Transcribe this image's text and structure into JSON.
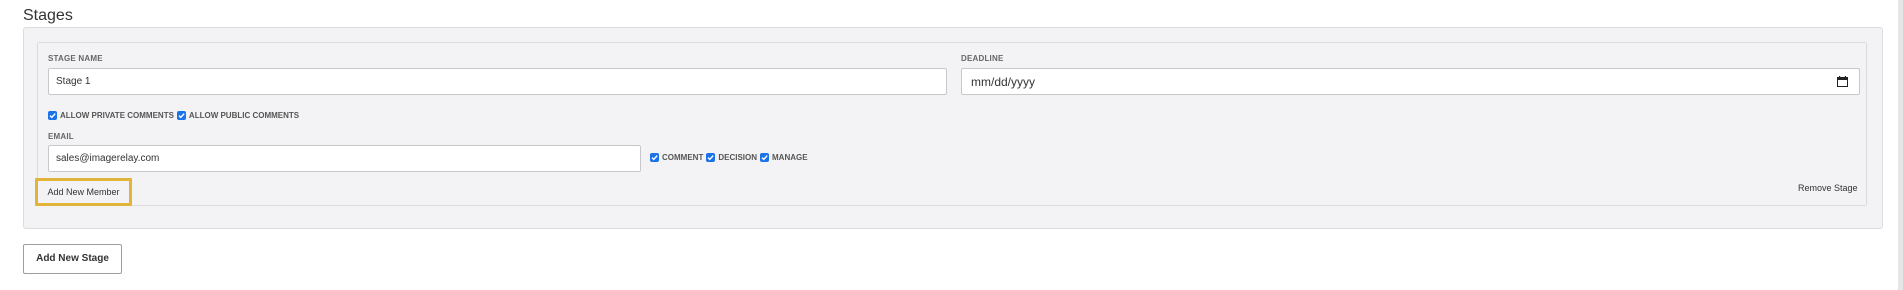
{
  "section": {
    "title": "Stages"
  },
  "stage": {
    "name_label": "STAGE NAME",
    "name_value": "Stage 1",
    "deadline_label": "DEADLINE",
    "deadline_placeholder": "mm/dd/yyyy",
    "allow_private_comments": {
      "label": "ALLOW PRIVATE COMMENTS",
      "checked": true
    },
    "allow_public_comments": {
      "label": "ALLOW PUBLIC COMMENTS",
      "checked": true
    },
    "email_label": "EMAIL",
    "email_value": "sales@imagerelay.com",
    "permissions": [
      {
        "label": "COMMENT",
        "checked": true
      },
      {
        "label": "DECISION",
        "checked": true
      },
      {
        "label": "MANAGE",
        "checked": true
      }
    ],
    "add_member_label": "Add New Member",
    "remove_stage_label": "Remove Stage"
  },
  "actions": {
    "add_stage_label": "Add New Stage"
  },
  "colors": {
    "checkbox": "#1a73e8",
    "highlight": "#e3b43a",
    "panel_bg": "#f3f3f5"
  },
  "icons": {
    "deadline": "calendar-icon",
    "checkbox": "check-icon"
  }
}
